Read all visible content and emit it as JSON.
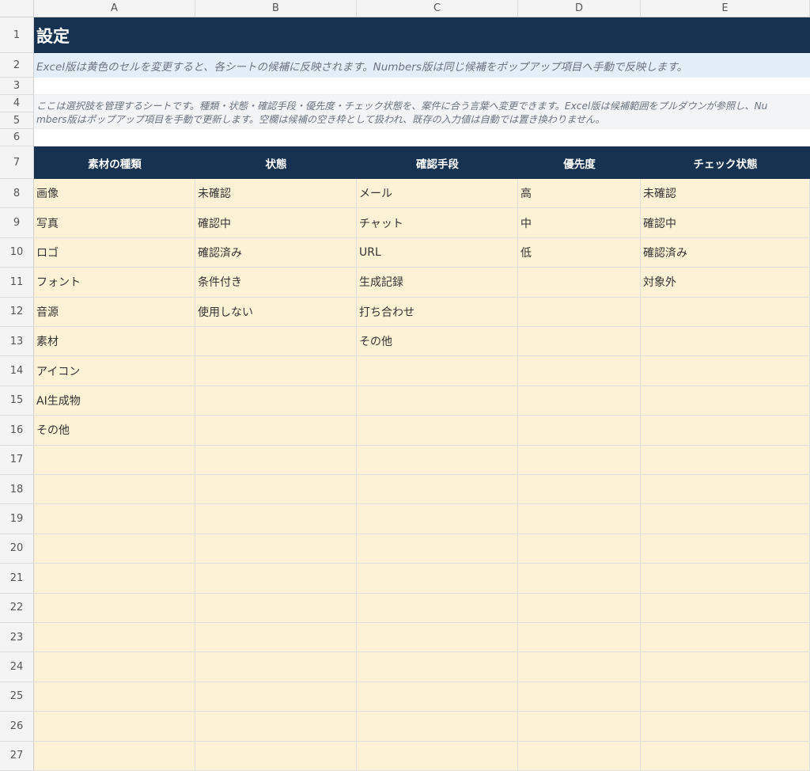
{
  "columns": [
    "A",
    "B",
    "C",
    "D",
    "E"
  ],
  "row_numbers": [
    "1",
    "2",
    "3",
    "4",
    "5",
    "6",
    "7",
    "8",
    "9",
    "10",
    "11",
    "12",
    "13",
    "14",
    "15",
    "16",
    "17",
    "18",
    "19",
    "20",
    "21",
    "22",
    "23",
    "24",
    "25",
    "26",
    "27"
  ],
  "title": "設定",
  "note": "Excel版は黄色のセルを変更すると、各シートの候補に反映されます。Numbers版は同じ候補をポップアップ項目へ手動で反映します。",
  "description": {
    "line1": "ここは選択肢を管理するシートです。種類・状態・確認手段・優先度・チェック状態を、案件に合う言葉へ変更できます。Excel版は候補範囲をプルダウンが参照し、Nu",
    "line2": "mbers版はポップアップ項目を手動で更新します。空欄は候補の空き枠として扱われ、既存の入力値は自動では置き換わりません。"
  },
  "table": {
    "headers": [
      "素材の種類",
      "状態",
      "確認手段",
      "優先度",
      "チェック状態"
    ],
    "rows": [
      [
        "画像",
        "未確認",
        "メール",
        "高",
        "未確認"
      ],
      [
        "写真",
        "確認中",
        "チャット",
        "中",
        "確認中"
      ],
      [
        "ロゴ",
        "確認済み",
        "URL",
        "低",
        "確認済み"
      ],
      [
        "フォント",
        "条件付き",
        "生成記録",
        "",
        "対象外"
      ],
      [
        "音源",
        "使用しない",
        "打ち合わせ",
        "",
        ""
      ],
      [
        "素材",
        "",
        "その他",
        "",
        ""
      ],
      [
        "アイコン",
        "",
        "",
        "",
        ""
      ],
      [
        "AI生成物",
        "",
        "",
        "",
        ""
      ],
      [
        "その他",
        "",
        "",
        "",
        ""
      ],
      [
        "",
        "",
        "",
        "",
        ""
      ],
      [
        "",
        "",
        "",
        "",
        ""
      ],
      [
        "",
        "",
        "",
        "",
        ""
      ],
      [
        "",
        "",
        "",
        "",
        ""
      ],
      [
        "",
        "",
        "",
        "",
        ""
      ],
      [
        "",
        "",
        "",
        "",
        ""
      ],
      [
        "",
        "",
        "",
        "",
        ""
      ],
      [
        "",
        "",
        "",
        "",
        ""
      ],
      [
        "",
        "",
        "",
        "",
        ""
      ],
      [
        "",
        "",
        "",
        "",
        ""
      ],
      [
        "",
        "",
        "",
        "",
        ""
      ]
    ]
  },
  "colors": {
    "header_navy": "#173250",
    "note_band": "#e4eef8",
    "input_cell_yellow": "#fef2d6"
  }
}
